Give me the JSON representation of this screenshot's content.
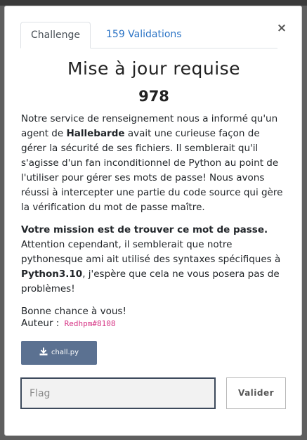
{
  "modal": {
    "tabs": [
      {
        "label": "Challenge",
        "active": true
      },
      {
        "label": "159 Validations",
        "active": false
      }
    ],
    "close_symbol": "×",
    "title": "Mise à jour requise",
    "points": "978"
  },
  "description": {
    "p1": {
      "t1": "Notre service de renseignement nous a informé qu'un agent de ",
      "b1": "Hallebarde",
      "t2": " avait une curieuse façon de gérer la sécurité de ses fichiers. Il semblerait qu'il s'agisse d'un fan inconditionnel de Python au point de l'utiliser pour gérer ses mots de passe! Nous avons réussi à intercepter une partie du code source qui gère la vérification du mot de passe maître."
    },
    "p2": {
      "b1": "Votre mission est de trouver ce mot de passe.",
      "t1": " Attention cependant, il semblerait que notre pythonesque ami ait utilisé des syntaxes spécifiques à ",
      "b2": "Python3.10",
      "t2": ", j'espère que cela ne vous posera pas de problèmes!"
    },
    "p3": "Bonne chance à vous!"
  },
  "author": {
    "label": "Auteur :",
    "name": "Redhpm#8108"
  },
  "download": {
    "label": "chall.py",
    "icon": "download-icon"
  },
  "flag_form": {
    "placeholder": "Flag",
    "value": "",
    "submit_label": "Valider"
  },
  "colors": {
    "tab_link": "#2a73c5",
    "author_link": "#d63384",
    "download_button": "#5b7191",
    "input_border": "#3d4a5c"
  }
}
